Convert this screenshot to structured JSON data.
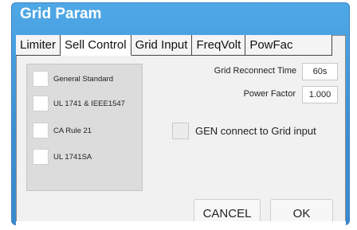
{
  "window": {
    "title": "Grid Param"
  },
  "tabs": [
    {
      "label": "Limiter"
    },
    {
      "label": "Sell Control"
    },
    {
      "label": "Grid Input"
    },
    {
      "label": "FreqVolt"
    },
    {
      "label": "PowFac"
    }
  ],
  "active_tab": "Sell Control",
  "standards": [
    {
      "label": "General Standard",
      "checked": false
    },
    {
      "label": "UL 1741 & IEEE1547",
      "checked": false
    },
    {
      "label": "CA Rule 21",
      "checked": false
    },
    {
      "label": "UL 1741SA",
      "checked": false
    }
  ],
  "fields": {
    "grid_reconnect_time": {
      "label": "Grid Reconnect Time",
      "value": "60s"
    },
    "power_factor": {
      "label": "Power Factor",
      "value": "1.000"
    }
  },
  "gen_connect": {
    "label": "GEN connect to Grid input",
    "checked": false
  },
  "buttons": {
    "cancel": "CANCEL",
    "ok": "OK"
  }
}
